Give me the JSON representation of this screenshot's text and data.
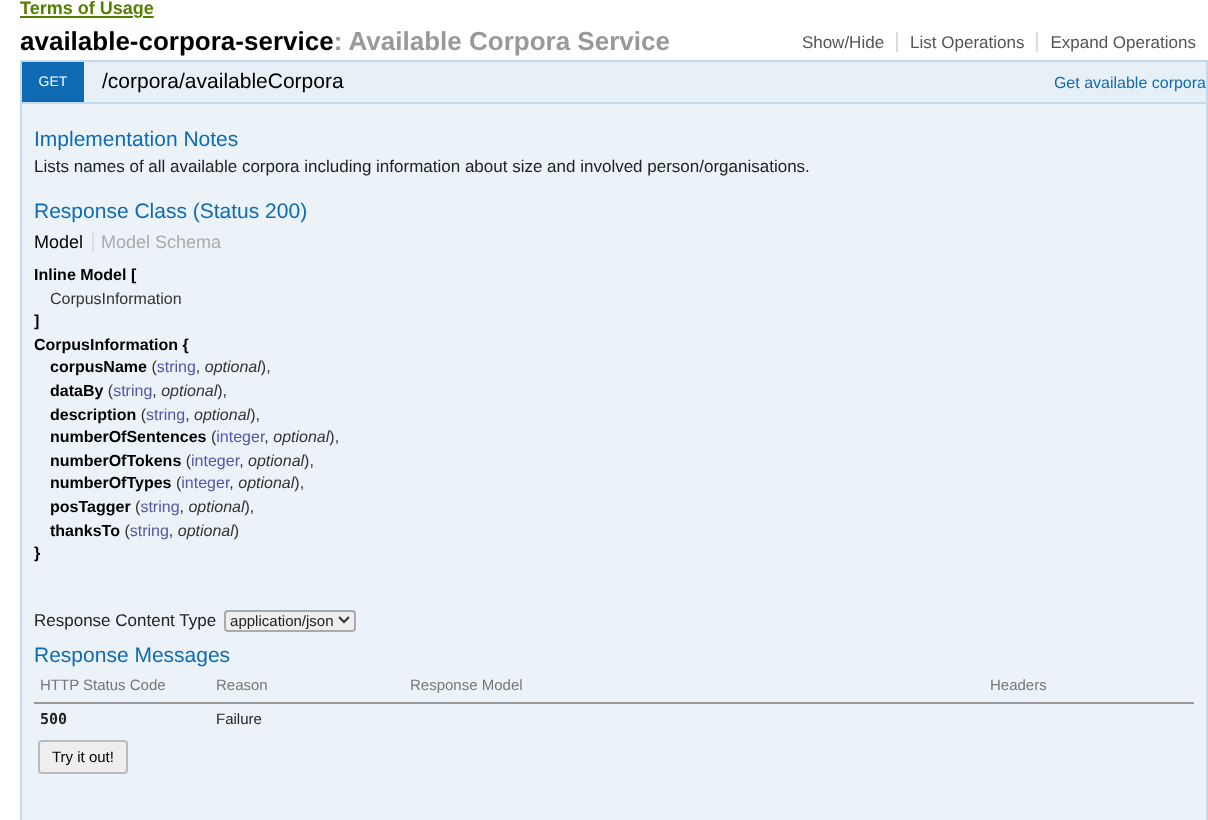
{
  "top_link": "Terms of Usage",
  "resource": {
    "name": "available-corpora-service",
    "separator": ": ",
    "description": "Available Corpora Service",
    "actions": [
      "Show/Hide",
      "List Operations",
      "Expand Operations"
    ]
  },
  "operation": {
    "method": "GET",
    "path": "/corpora/availableCorpora",
    "summary": "Get available corpora",
    "notes_heading": "Implementation Notes",
    "notes": "Lists names of all available corpora including information about size and involved person/organisations.",
    "response_class_heading": "Response Class (Status 200)",
    "model_tabs": [
      {
        "label": "Model",
        "selected": true
      },
      {
        "label": "Model Schema",
        "selected": false
      }
    ],
    "model_lines": [
      {
        "kind": "bold",
        "text": "Inline Model ["
      },
      {
        "kind": "indent",
        "text": "CorpusInformation"
      },
      {
        "kind": "bold",
        "text": "]"
      },
      {
        "kind": "bold",
        "text": "CorpusInformation {"
      }
    ],
    "fields": [
      {
        "name": "corpusName",
        "open": " (",
        "type": "string",
        "sep": ", ",
        "flag": "optional",
        "close": "),"
      },
      {
        "name": "dataBy",
        "open": " (",
        "type": "string",
        "sep": ", ",
        "flag": "optional",
        "close": "),"
      },
      {
        "name": "description",
        "open": " (",
        "type": "string",
        "sep": ", ",
        "flag": "optional",
        "close": "),"
      },
      {
        "name": "numberOfSentences",
        "open": " (",
        "type": "integer",
        "sep": ", ",
        "flag": "optional",
        "close": "),"
      },
      {
        "name": "numberOfTokens",
        "open": " (",
        "type": "integer",
        "sep": ", ",
        "flag": "optional",
        "close": "),"
      },
      {
        "name": "numberOfTypes",
        "open": " (",
        "type": "integer",
        "sep": ", ",
        "flag": "optional",
        "close": "),"
      },
      {
        "name": "posTagger",
        "open": " (",
        "type": "string",
        "sep": ", ",
        "flag": "optional",
        "close": "),"
      },
      {
        "name": "thanksTo",
        "open": " (",
        "type": "string",
        "sep": ", ",
        "flag": "optional",
        "close": ")"
      }
    ],
    "model_close": "}",
    "content_type_label": "Response Content Type",
    "content_type": "application/json",
    "messages_heading": "Response Messages",
    "messages_columns": [
      "HTTP Status Code",
      "Reason",
      "Response Model",
      "Headers"
    ],
    "messages_rows": [
      [
        "500",
        "Failure",
        "",
        ""
      ]
    ],
    "try_button": "Try it out!"
  }
}
